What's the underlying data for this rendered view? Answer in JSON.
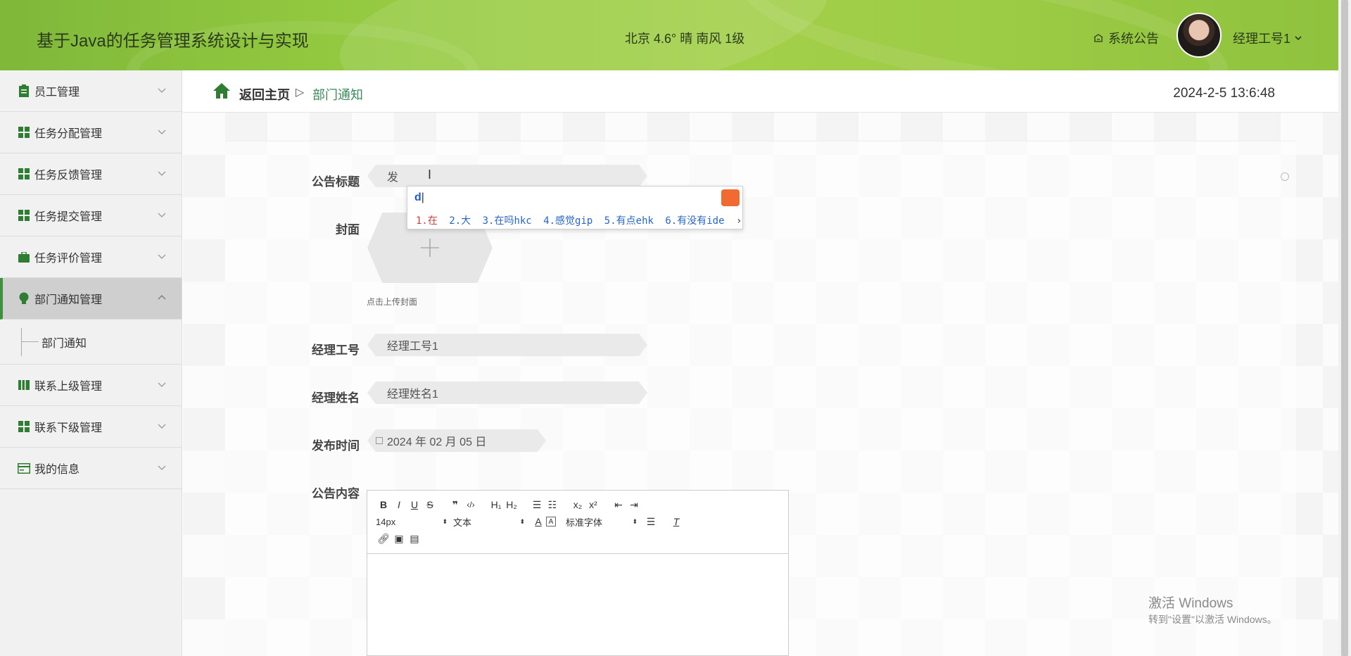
{
  "header": {
    "title": "基于Java的任务管理系统设计与实现",
    "weather": "北京  4.6°  晴  南风  1级",
    "notice": "系统公告",
    "user": "经理工号1"
  },
  "sidebar": {
    "items": [
      {
        "label": "员工管理"
      },
      {
        "label": "任务分配管理"
      },
      {
        "label": "任务反馈管理"
      },
      {
        "label": "任务提交管理"
      },
      {
        "label": "任务评价管理"
      },
      {
        "label": "部门通知管理"
      },
      {
        "label": "联系上级管理"
      },
      {
        "label": "联系下级管理"
      },
      {
        "label": "我的信息"
      }
    ],
    "sub_item": "部门通知"
  },
  "breadcrumb": {
    "home": "返回主页",
    "sep": "▷",
    "current": "部门通知"
  },
  "datetime": "2024-2-5 13:6:48",
  "form": {
    "title_label": "公告标题",
    "title_value": "发",
    "cover_label": "封面",
    "cover_hint": "点击上传封面",
    "manager_id_label": "经理工号",
    "manager_id_value": "经理工号1",
    "manager_name_label": "经理姓名",
    "manager_name_value": "经理姓名1",
    "publish_time_label": "发布时间",
    "publish_time_value": "2024 年 02 月 05 日",
    "content_label": "公告内容"
  },
  "ime": {
    "input": "d",
    "candidates": [
      "1.在",
      "2.大",
      "3.在吗hkc",
      "4.感觉gip",
      "5.有点ehk",
      "6.有没有ide"
    ]
  },
  "editor": {
    "font_size": "14px",
    "text_type": "文本",
    "font_family": "标准字体"
  },
  "watermark": {
    "line1": "激活 Windows",
    "line2": "转到\"设置\"以激活 Windows。"
  },
  "colors": {
    "header_green": "#93c940",
    "accent_green": "#3e8f3e",
    "link_green": "#3b8a5a",
    "ime_blue": "#2566c8",
    "ime_red": "#d23c3c"
  }
}
